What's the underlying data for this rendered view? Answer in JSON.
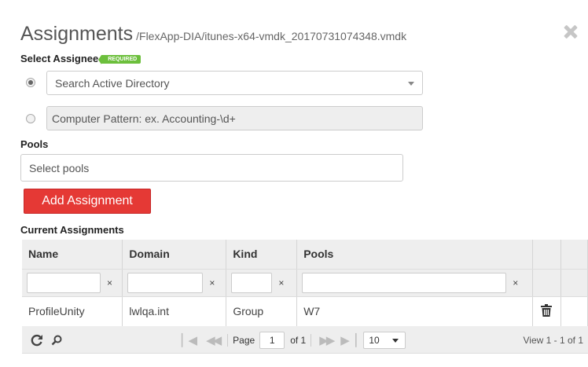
{
  "header": {
    "title": "Assignments",
    "path": "/FlexApp-DIA/itunes-x64-vmdk_20170731074348.vmdk"
  },
  "assignee": {
    "label": "Select Assignee",
    "badge": "REQUIRED",
    "ad_placeholder": "Search Active Directory",
    "pattern_placeholder": "Computer Pattern: ex. Accounting-\\d+",
    "selected": "ad"
  },
  "pools": {
    "label": "Pools",
    "placeholder": "Select pools"
  },
  "add_button": "Add Assignment",
  "current": {
    "label": "Current Assignments",
    "columns": [
      "Name",
      "Domain",
      "Kind",
      "Pools"
    ],
    "clear_symbol": "×",
    "rows": [
      {
        "name": "ProfileUnity",
        "domain": "lwlqa.int",
        "kind": "Group",
        "pools": "W7"
      }
    ]
  },
  "pager": {
    "page_label": "Page",
    "page_value": "1",
    "of_label": "of 1",
    "rows_per_page": "10",
    "view_text": "View 1 - 1 of 1"
  },
  "icons": [
    "close-icon",
    "refresh-icon",
    "search-icon",
    "trash-icon",
    "first-page-icon",
    "prev-page-icon",
    "next-page-icon",
    "last-page-icon",
    "dropdown-caret-icon"
  ],
  "colors": {
    "accent": "#e53935",
    "required_badge": "#6cbf3c"
  }
}
